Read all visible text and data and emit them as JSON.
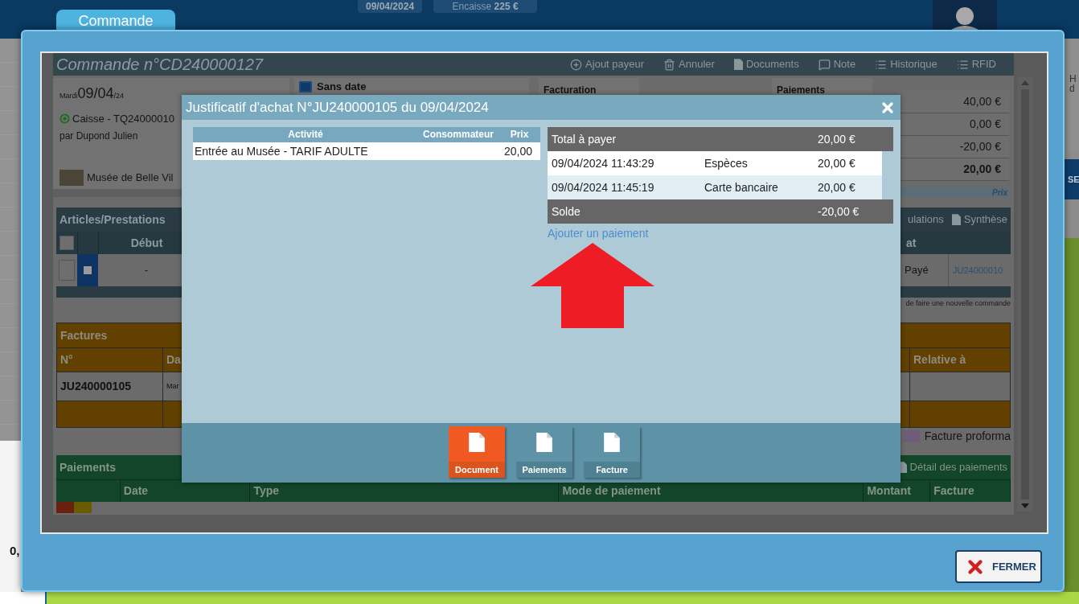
{
  "topbar": {
    "date": "09/04/2024",
    "cash_label": "Encaisse",
    "cash_amount": "225 €"
  },
  "background": {
    "left_value": "0,",
    "right_labels": [
      "H",
      "d"
    ],
    "right_button": "SE"
  },
  "tab": {
    "label": "Commande",
    "selected": true
  },
  "order": {
    "title": "Commande n°CD240000127",
    "toolbar": [
      "Ajout payeur",
      "Annuler",
      "Documents",
      "Note",
      "Historique",
      "RFID"
    ],
    "summary": {
      "day": "Mardi",
      "date": "09/04",
      "year": "/24",
      "channel": "Caisse - TQ24000010",
      "by": "par Dupond Julien",
      "venue": "Musée de Belle Vil"
    },
    "schedule": {
      "label": "Sans date",
      "checked": false
    },
    "billing": {
      "title": "Facturation"
    },
    "payments_card": {
      "title": "Paiements",
      "note": "Prix",
      "amounts": [
        {
          "value": "40,00 €",
          "bold": false
        },
        {
          "value": "0,00 €",
          "bold": false
        },
        {
          "value": "-20,00 €",
          "bold": false
        },
        {
          "value": "20,00 €",
          "bold": true
        }
      ]
    },
    "articles": {
      "title": "Articles/Prestations",
      "actions": [
        "ulations",
        "Synthèse"
      ],
      "all_checked": false,
      "columns": [
        "Début",
        "at"
      ],
      "rows": [
        {
          "checked": false,
          "start": "-",
          "status": "Payé",
          "invoice": "JU24000010"
        }
      ],
      "note": "de faire une nouvelle commande"
    },
    "invoices": {
      "title": "Factures",
      "columns": [
        "N°",
        "Da",
        "Relative à"
      ],
      "rows": [
        {
          "number": "JU240000105",
          "date": "Mar"
        }
      ],
      "legend": "Facture proforma"
    },
    "payments": {
      "title": "Paiements",
      "action": "Détail des paiements",
      "columns": [
        "Date",
        "Type",
        "Mode de paiement",
        "Montant",
        "Facture"
      ]
    }
  },
  "modal": {
    "title": "Justificatif d'achat N°JU240000105 du 09/04/2024",
    "items": {
      "columns": [
        "Activité",
        "Consommateur",
        "Prix"
      ],
      "rows": [
        {
          "activity": "Entrée au Musée - TARIF ADULTE",
          "price": "20,00"
        }
      ]
    },
    "total": {
      "label": "Total à payer",
      "amount": "20,00 €"
    },
    "payments": [
      {
        "date": "09/04/2024 11:43:29",
        "mode": "Espèces",
        "amount": "20,00 €"
      },
      {
        "date": "09/04/2024 11:45:19",
        "mode": "Carte bancaire",
        "amount": "20,00 €"
      }
    ],
    "balance": {
      "label": "Solde",
      "amount": "-20,00 €"
    },
    "add_link": "Ajouter un paiement",
    "buttons": [
      {
        "label": "Document",
        "selected": true
      },
      {
        "label": "Paiements",
        "selected": false
      },
      {
        "label": "Facture",
        "selected": false
      }
    ]
  },
  "close_button": "FERMER"
}
